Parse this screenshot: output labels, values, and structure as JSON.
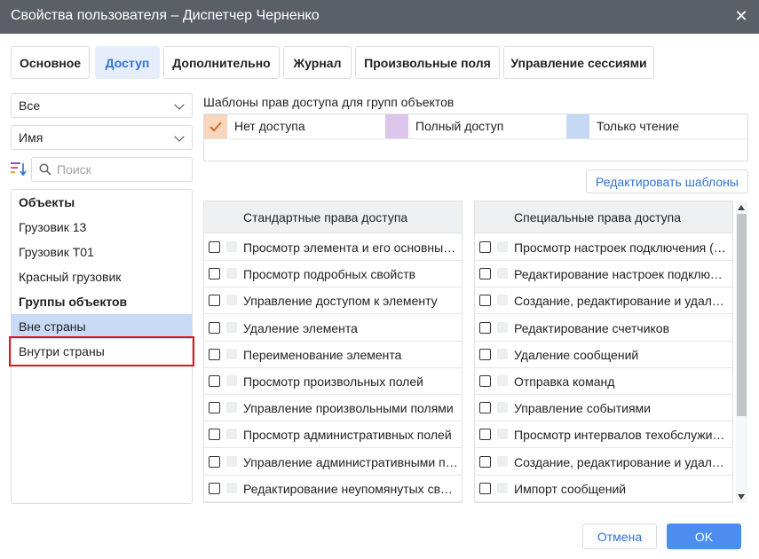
{
  "window": {
    "title": "Свойства пользователя – Диспетчер Черненко"
  },
  "tabs": [
    {
      "label": "Основное",
      "active": false
    },
    {
      "label": "Доступ",
      "active": true
    },
    {
      "label": "Дополнительно",
      "active": false
    },
    {
      "label": "Журнал",
      "active": false
    },
    {
      "label": "Произвольные поля",
      "active": false
    },
    {
      "label": "Управление сессиями",
      "active": false
    }
  ],
  "filters": {
    "type_value": "Все",
    "sort_value": "Имя",
    "search_placeholder": "Поиск"
  },
  "objects": {
    "header_objects": "Объекты",
    "items": [
      "Грузовик 13",
      "Грузовик Т01",
      "Красный грузовик"
    ],
    "header_groups": "Группы объектов",
    "groups": [
      {
        "label": "Вне страны",
        "selected": true
      },
      {
        "label": "Внутри страны",
        "selected": false
      }
    ]
  },
  "templates": {
    "label": "Шаблоны прав доступа для групп объектов",
    "items": [
      {
        "label": "Нет доступа",
        "color": "#f7d6bd",
        "checked": true
      },
      {
        "label": "Полный доступ",
        "color": "#dcc5ea",
        "checked": false
      },
      {
        "label": "Только чтение",
        "color": "#c5d8f4",
        "checked": false
      }
    ],
    "edit_label": "Редактировать шаблоны"
  },
  "standard": {
    "header": "Стандартные права доступа",
    "items": [
      "Просмотр элемента и его основных свойств",
      "Просмотр подробных свойств",
      "Управление доступом к элементу",
      "Удаление элемента",
      "Переименование элемента",
      "Просмотр произвольных полей",
      "Управление произвольными полями",
      "Просмотр административных полей",
      "Управление административными полями",
      "Редактирование неупомянутых свойств"
    ]
  },
  "special": {
    "header": "Специальные права доступа",
    "items": [
      "Просмотр настроек подключения (устройство, уникальный ID, телефон, пароль доступа)",
      "Редактирование настроек подключения",
      "Создание, редактирование и удаление датчиков",
      "Редактирование счетчиков",
      "Удаление сообщений",
      "Отправка команд",
      "Управление событиями",
      "Просмотр интервалов техобслуживания",
      "Создание, редактирование и удаление интервалов техобслуживания",
      "Импорт сообщений"
    ]
  },
  "footer": {
    "cancel_label": "Отмена",
    "ok_label": "OK"
  },
  "colors": {
    "accent": "#2f73d1",
    "ok_button": "#4b8ef0",
    "selection": "#c8daf6",
    "highlight_border": "#e3141c"
  }
}
